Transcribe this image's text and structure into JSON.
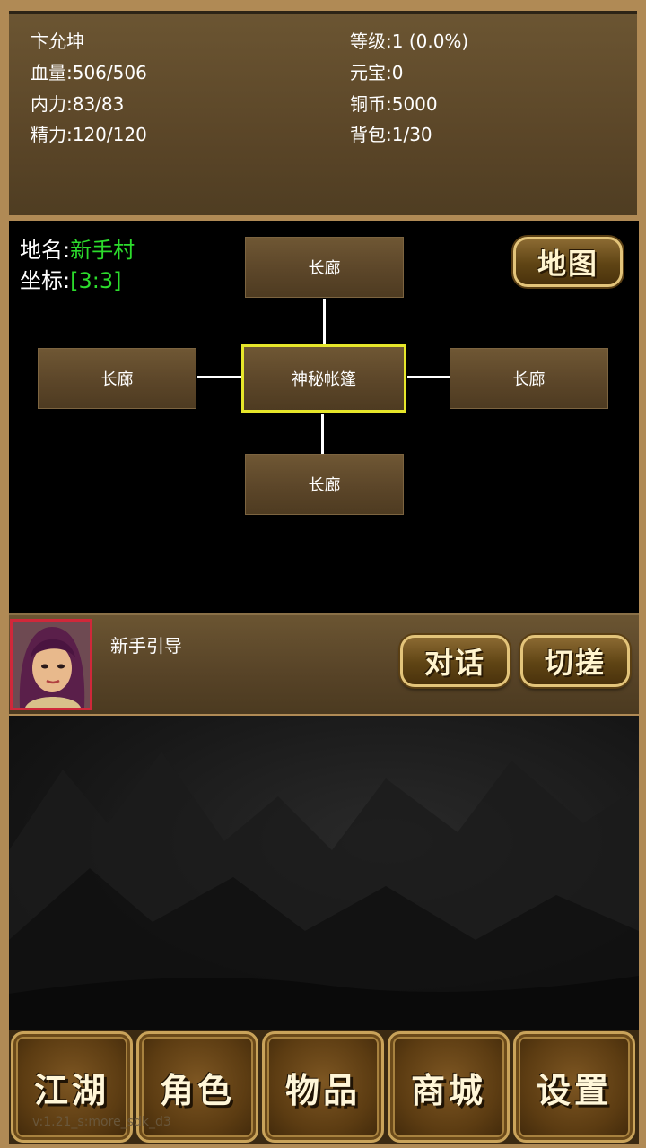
{
  "player": {
    "name": "卞允坤",
    "hp": "血量:506/506",
    "mp": "内力:83/83",
    "stamina": "精力:120/120",
    "level": "等级:1 (0.0%)",
    "yuanbao": "元宝:0",
    "copper": "铜币:5000",
    "bag": "背包:1/30"
  },
  "location": {
    "name_label": "地名:",
    "name_value": "新手村",
    "coord_label": "坐标:",
    "coord_value": "[3:3]",
    "map_button": "地图"
  },
  "rooms": {
    "north": "长廊",
    "west": "长廊",
    "center": "神秘帐篷",
    "east": "长廊",
    "south": "长廊"
  },
  "npc": {
    "name": "新手引导",
    "talk_button": "对话",
    "spar_button": "切搓"
  },
  "nav": {
    "jianghu": "江湖",
    "role": "角色",
    "items": "物品",
    "shop": "商城",
    "settings": "设置"
  },
  "version": "v:1.21_s:more_sdk_d3",
  "colors": {
    "location_highlight": "#2cdc2c",
    "current_room_border": "#e6e62a",
    "avatar_border": "#d0283a"
  }
}
